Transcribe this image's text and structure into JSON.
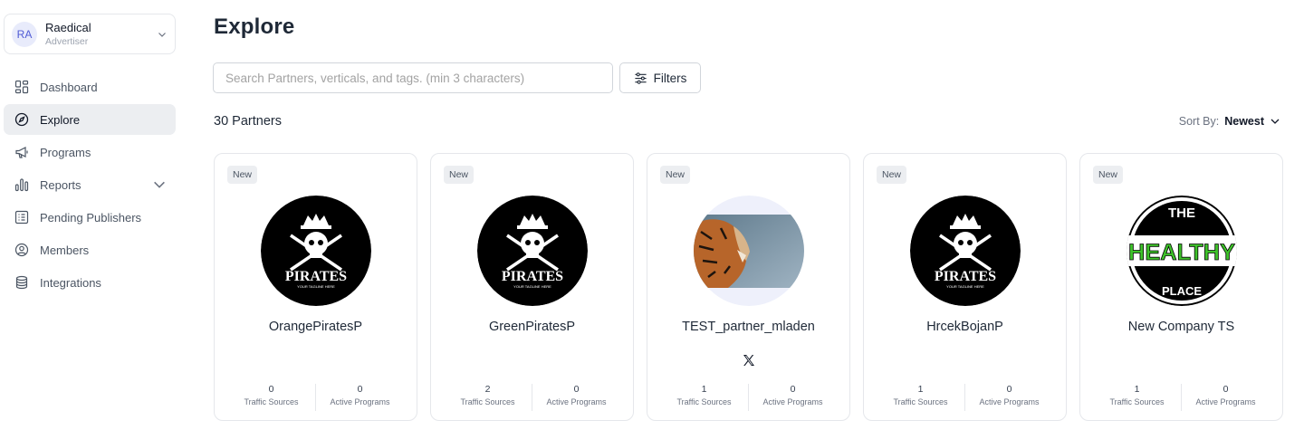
{
  "account": {
    "initials": "RA",
    "name": "Raedical",
    "role": "Advertiser"
  },
  "nav": [
    {
      "label": "Dashboard",
      "icon": "dashboard-icon",
      "active": false
    },
    {
      "label": "Explore",
      "icon": "compass-icon",
      "active": true
    },
    {
      "label": "Programs",
      "icon": "megaphone-icon",
      "active": false
    },
    {
      "label": "Reports",
      "icon": "bar-chart-icon",
      "active": false,
      "expandable": true
    },
    {
      "label": "Pending Publishers",
      "icon": "list-icon",
      "active": false
    },
    {
      "label": "Members",
      "icon": "user-circle-icon",
      "active": false
    },
    {
      "label": "Integrations",
      "icon": "database-icon",
      "active": false
    }
  ],
  "page": {
    "title": "Explore"
  },
  "search": {
    "placeholder": "Search Partners, verticals, and tags. (min 3 characters)"
  },
  "filters": {
    "label": "Filters"
  },
  "results": {
    "count_label": "30 Partners"
  },
  "sort": {
    "label": "Sort By:",
    "value": "Newest"
  },
  "cards": [
    {
      "badge": "New",
      "name": "OrangePiratesP",
      "logo": "pirates-logo",
      "logo_text": "PIRATES",
      "logo_tagline": "YOUR TAGLINE HERE",
      "traffic_sources": "0",
      "active_programs": "0",
      "traffic_label": "Traffic Sources",
      "programs_label": "Active Programs"
    },
    {
      "badge": "New",
      "name": "GreenPiratesP",
      "logo": "pirates-logo",
      "logo_text": "PIRATES",
      "logo_tagline": "YOUR TAGLINE HERE",
      "traffic_sources": "2",
      "active_programs": "0",
      "traffic_label": "Traffic Sources",
      "programs_label": "Active Programs"
    },
    {
      "badge": "New",
      "name": "TEST_partner_mladen",
      "logo": "tiger-photo",
      "social": "x-icon",
      "traffic_sources": "1",
      "active_programs": "0",
      "traffic_label": "Traffic Sources",
      "programs_label": "Active Programs"
    },
    {
      "badge": "New",
      "name": "HrcekBojanP",
      "logo": "pirates-logo",
      "logo_text": "PIRATES",
      "logo_tagline": "YOUR TAGLINE HERE",
      "traffic_sources": "1",
      "active_programs": "0",
      "traffic_label": "Traffic Sources",
      "programs_label": "Active Programs"
    },
    {
      "badge": "New",
      "name": "New Company TS",
      "logo": "healthy-place-logo",
      "logo_text_top": "THE",
      "logo_text_mid": "HEALTHY",
      "logo_text_bottom": "PLACE",
      "traffic_sources": "1",
      "active_programs": "0",
      "traffic_label": "Traffic Sources",
      "programs_label": "Active Programs"
    }
  ],
  "colors": {
    "accent": "#4f5bd5",
    "active_nav_bg": "#eceef1",
    "border": "#e5e7eb",
    "healthy_green": "#3ec32a"
  }
}
